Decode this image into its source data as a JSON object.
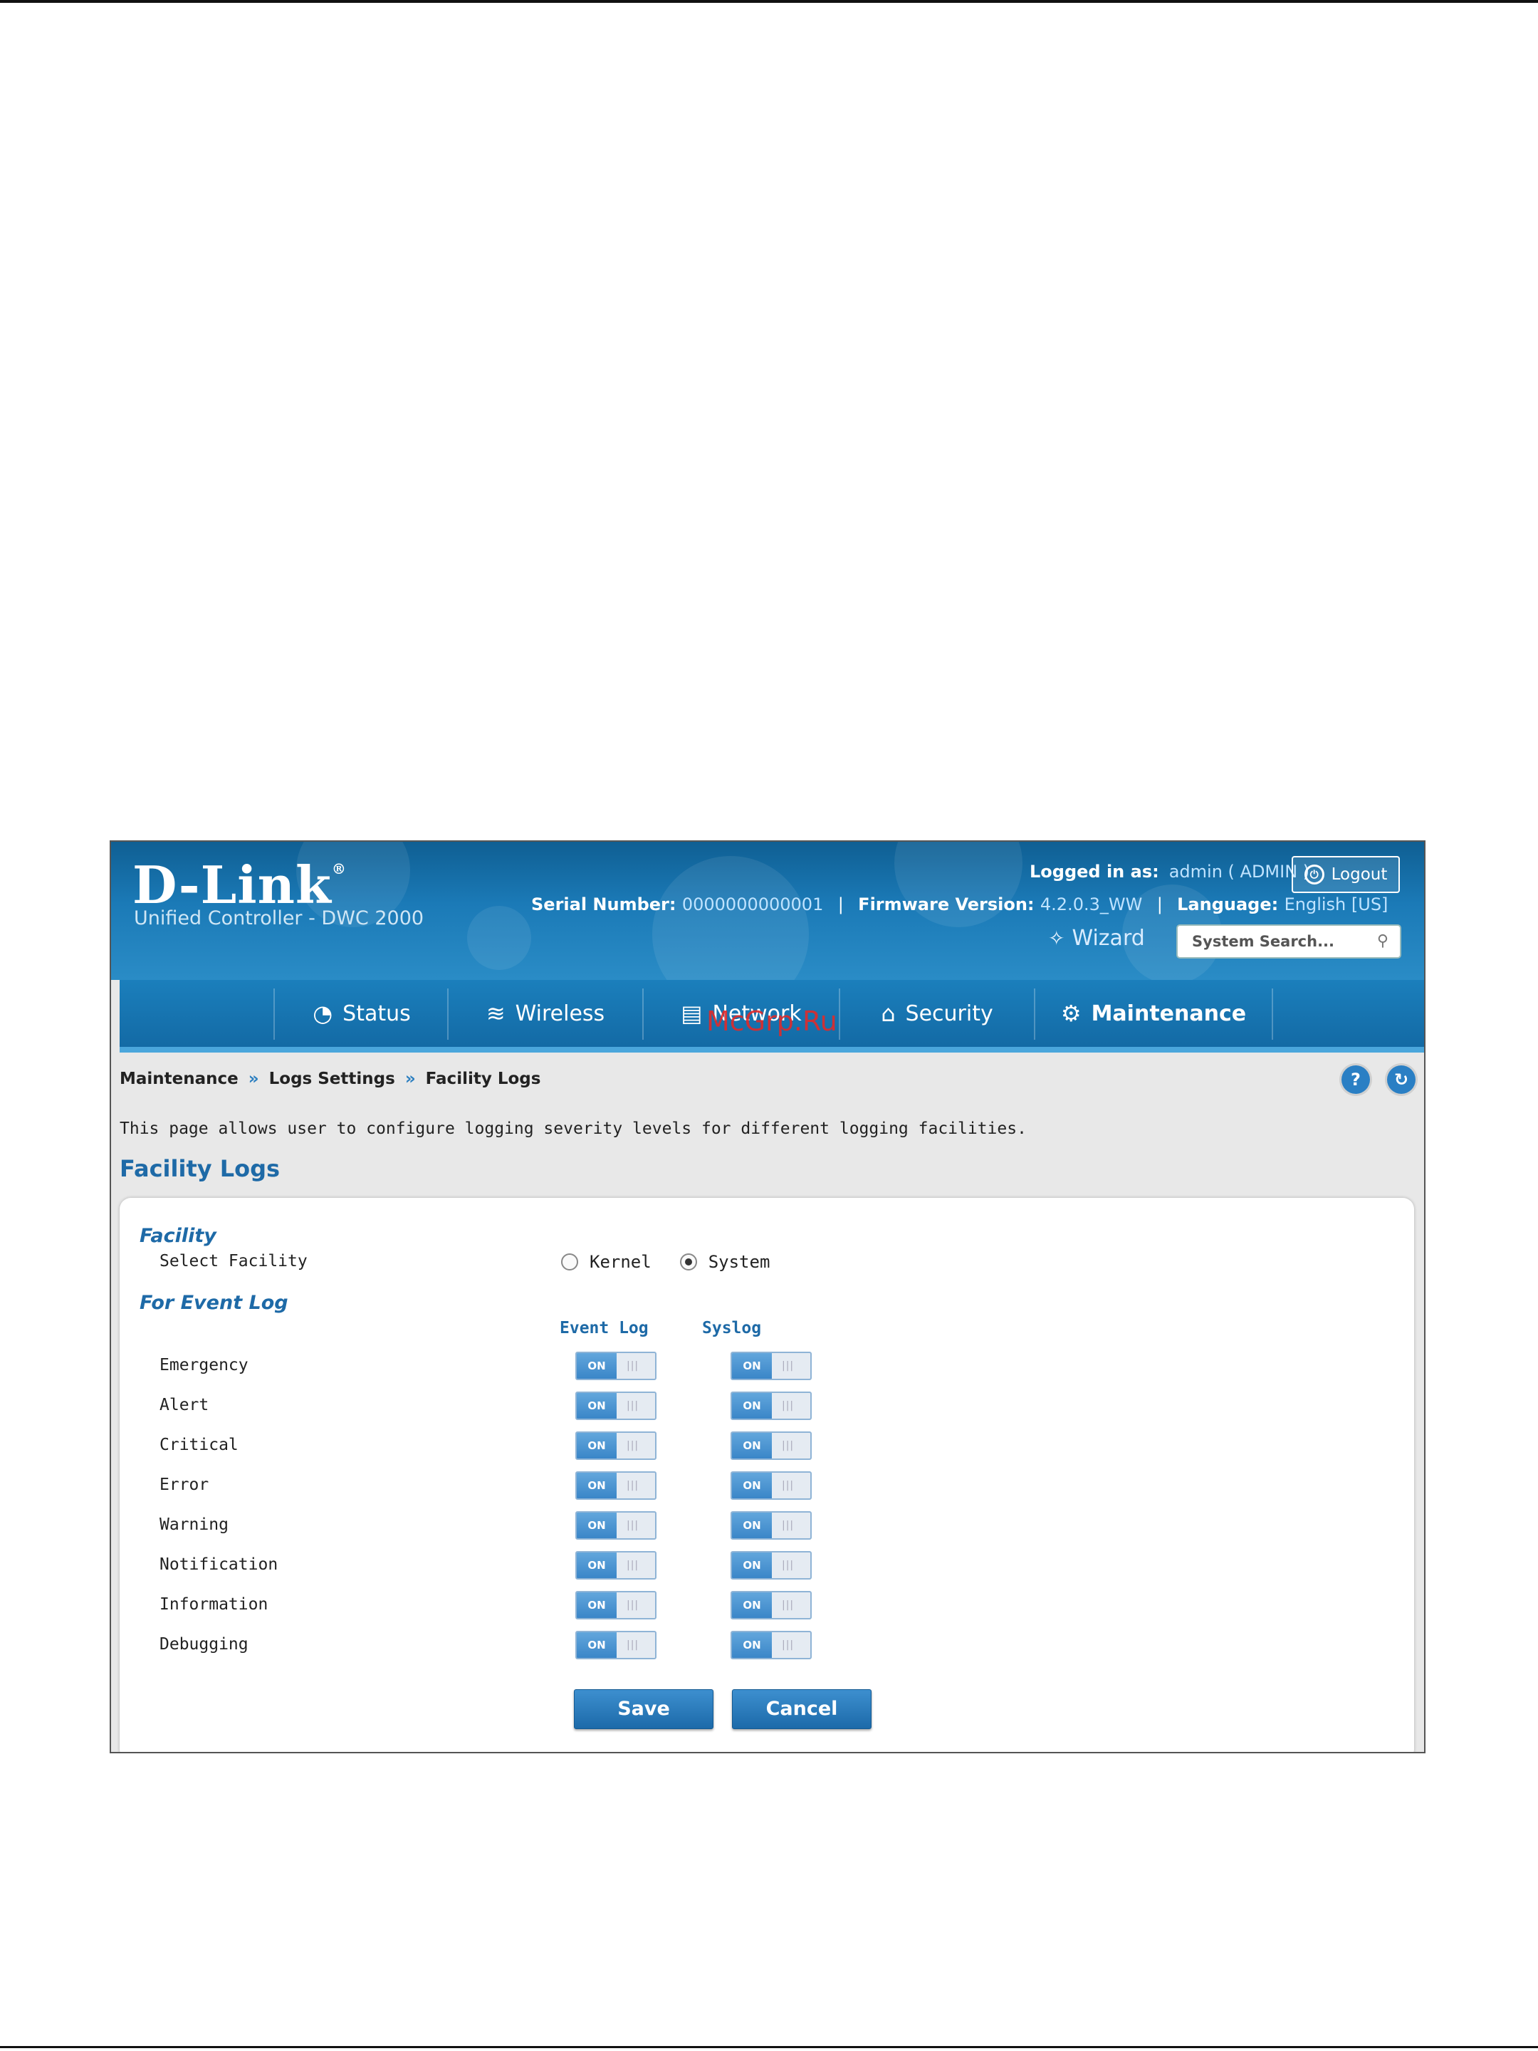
{
  "header": {
    "brand": "D-Link",
    "brand_mark": "®",
    "subtitle": "Unified Controller - DWC 2000",
    "logged_in_label": "Logged in as:",
    "logged_in_value": "admin ( ADMIN )",
    "logout_label": "Logout",
    "serial_label": "Serial Number:",
    "serial_value": "0000000000001",
    "firmware_label": "Firmware Version:",
    "firmware_value": "4.2.0.3_WW",
    "language_label": "Language:",
    "language_value": "English [US]",
    "wizard_label": "Wizard",
    "search_placeholder": "System Search..."
  },
  "nav": {
    "items": [
      {
        "label": "Status",
        "icon": "gauge-icon"
      },
      {
        "label": "Wireless",
        "icon": "wifi-icon"
      },
      {
        "label": "Network",
        "icon": "computer-icon"
      },
      {
        "label": "Security",
        "icon": "lock-icon"
      },
      {
        "label": "Maintenance",
        "icon": "gear-icon"
      }
    ],
    "active": "Maintenance"
  },
  "watermark": "McGrp.Ru",
  "breadcrumb": [
    "Maintenance",
    "Logs Settings",
    "Facility Logs"
  ],
  "breadcrumb_separator": "»",
  "description": "This page allows user to configure logging severity levels for different logging facilities.",
  "page_title": "Facility Logs",
  "facility": {
    "section_label": "Facility",
    "select_label": "Select Facility",
    "options": [
      "Kernel",
      "System"
    ],
    "selected": "System"
  },
  "event_log": {
    "section_label": "For Event Log",
    "col_event": "Event Log",
    "col_syslog": "Syslog",
    "toggle_on_text": "ON",
    "rows": [
      {
        "label": "Emergency",
        "event": "ON",
        "syslog": "ON"
      },
      {
        "label": "Alert",
        "event": "ON",
        "syslog": "ON"
      },
      {
        "label": "Critical",
        "event": "ON",
        "syslog": "ON"
      },
      {
        "label": "Error",
        "event": "ON",
        "syslog": "ON"
      },
      {
        "label": "Warning",
        "event": "ON",
        "syslog": "ON"
      },
      {
        "label": "Notification",
        "event": "ON",
        "syslog": "ON"
      },
      {
        "label": "Information",
        "event": "ON",
        "syslog": "ON"
      },
      {
        "label": "Debugging",
        "event": "ON",
        "syslog": "ON"
      }
    ]
  },
  "buttons": {
    "save": "Save",
    "cancel": "Cancel"
  },
  "colors": {
    "accent": "#1e6aa7",
    "nav": "#136aa5",
    "header": "#1b7ab7"
  }
}
